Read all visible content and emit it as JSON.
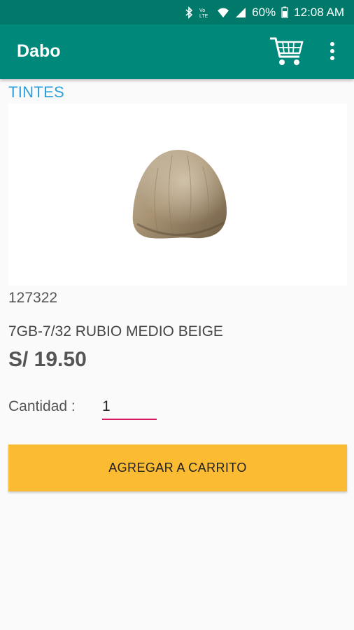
{
  "status_bar": {
    "battery": "60%",
    "time": "12:08 AM",
    "icons": [
      "bluetooth-icon",
      "volte-icon",
      "wifi-icon",
      "signal-icon",
      "battery-icon"
    ]
  },
  "app_bar": {
    "title": "Dabo",
    "color": "#00897b",
    "icons": [
      "cart-icon",
      "more-vert-icon"
    ]
  },
  "product": {
    "category": "TINTES",
    "code": "127322",
    "name": "7GB-7/32 RUBIO MEDIO BEIGE",
    "price": "S/ 19.50",
    "image": "hair-swatch-image"
  },
  "quantity": {
    "label": "Cantidad :",
    "value": "1"
  },
  "actions": {
    "add_to_cart_label": "AGREGAR A CARRITO",
    "button_color": "#fbbc33"
  }
}
